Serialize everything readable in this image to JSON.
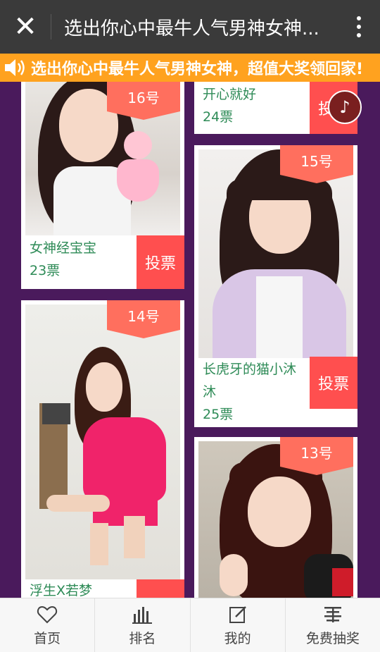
{
  "header": {
    "close_icon": "close-icon",
    "title": "选出你心中最牛人气男神女神...",
    "more_icon": "more-vertical-icon"
  },
  "marquee": {
    "speaker_icon": "speaker-icon",
    "text": "选出你心中最牛人气男神女神，超值大奖领回家!"
  },
  "cards": [
    {
      "number": "16号",
      "name": "女神经宝宝",
      "votes": "23票",
      "vote_label": "投票"
    },
    {
      "number": "",
      "name": "开心就好",
      "votes": "24票",
      "vote_label": "投"
    },
    {
      "number": "15号",
      "name": "长虎牙的猫小沐沐",
      "votes": "25票",
      "vote_label": "投票"
    },
    {
      "number": "14号",
      "name": "浮生X若梦",
      "votes": "",
      "vote_label": ""
    },
    {
      "number": "13号",
      "name": "",
      "votes": "",
      "vote_label": ""
    }
  ],
  "music_icon": "music-note-icon",
  "nav": [
    {
      "label": "首页",
      "icon": "heart-icon"
    },
    {
      "label": "排名",
      "icon": "bar-chart-icon"
    },
    {
      "label": "我的",
      "icon": "edit-icon"
    },
    {
      "label": "免费抽奖",
      "icon": "gift-icon"
    }
  ],
  "colors": {
    "background": "#4a1a5c",
    "header": "#3a3a3a",
    "marquee": "#ffa21f",
    "tag": "#ff6f5e",
    "vote_button": "#ff4f4f",
    "text_green": "#2e8b57"
  }
}
